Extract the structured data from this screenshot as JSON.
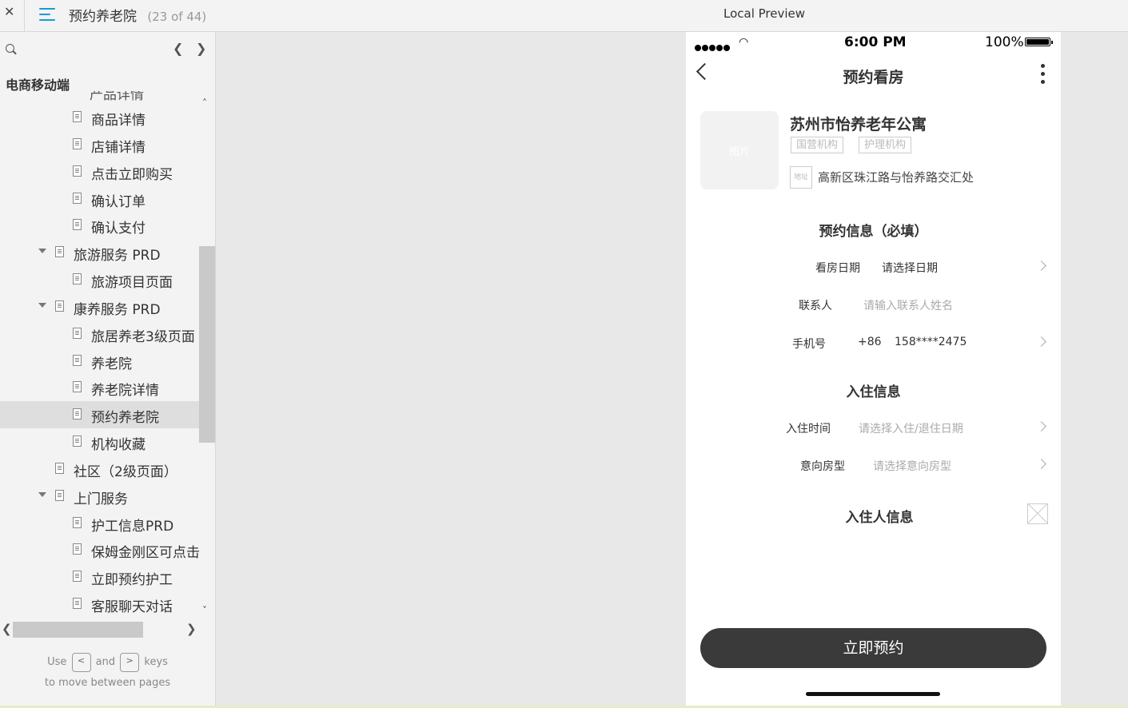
{
  "topbar": {
    "close_label": "✕",
    "page_name": "预约养老院",
    "page_count": "(23 of 44)",
    "preview_title": "Local Preview"
  },
  "sidebar": {
    "project_name": "电商移动端",
    "partial_item": "产品详情",
    "items": [
      {
        "label": "商品详情"
      },
      {
        "label": "店铺详情"
      },
      {
        "label": "点击立即购买"
      },
      {
        "label": "确认订单"
      },
      {
        "label": "确认支付"
      },
      {
        "label": "旅游服务 PRD"
      },
      {
        "label": "旅游项目页面"
      },
      {
        "label": "康养服务 PRD"
      },
      {
        "label": "旅居养老3级页面"
      },
      {
        "label": "养老院"
      },
      {
        "label": "养老院详情"
      },
      {
        "label": "预约养老院"
      },
      {
        "label": "机构收藏"
      },
      {
        "label": "社区（2级页面）"
      },
      {
        "label": "上门服务"
      },
      {
        "label": "护工信息PRD"
      },
      {
        "label": "保姆金刚区可点击"
      },
      {
        "label": "立即预约护工"
      },
      {
        "label": "客服聊天对话"
      }
    ],
    "hint_use": "Use",
    "hint_and": "and",
    "hint_keys": "keys",
    "hint_line2": "to move between pages",
    "key_left": "<",
    "key_right": ">"
  },
  "phone": {
    "status": {
      "time": "6:00 PM",
      "battery": "100%"
    },
    "nav_title": "预约看房",
    "thumb_label": "图片",
    "org_name": "苏州市怡养老年公寓",
    "tags": [
      "国营机构",
      "护理机构"
    ],
    "addr_icon_label": "地址",
    "address": "高新区珠江路与怡养路交汇处",
    "booking_section": "预约信息（必填）",
    "visit_date_label": "看房日期",
    "visit_date_value": "请选择日期",
    "contact_label": "联系人",
    "contact_placeholder": "请输入联系人姓名",
    "phone_label": "手机号",
    "phone_prefix": "+86",
    "phone_value": "158****2475",
    "checkin_section": "入住信息",
    "checkin_time_label": "入住时间",
    "checkin_time_placeholder": "请选择入住/退住日期",
    "room_type_label": "意向房型",
    "room_type_placeholder": "请选择意向房型",
    "resident_section": "入住人信息",
    "submit_label": "立即预约"
  }
}
